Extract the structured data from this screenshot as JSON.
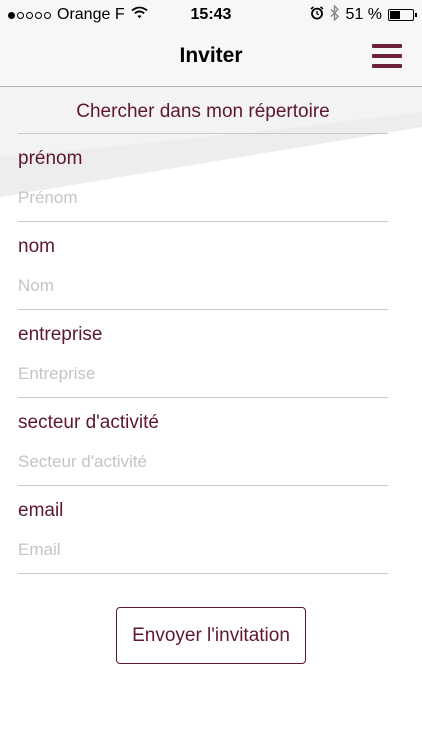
{
  "status_bar": {
    "carrier": "Orange F",
    "time": "15:43",
    "battery": "51 %",
    "battery_level": 0.51,
    "signal_bars_filled": 1,
    "signal_bars_total": 5,
    "icons": [
      "signal-dots-icon",
      "wifi-icon",
      "alarm-icon",
      "bluetooth-icon",
      "battery-icon"
    ]
  },
  "nav": {
    "title": "Inviter",
    "menu_icon": "hamburger-menu-icon"
  },
  "search_directory": "Chercher dans mon répertoire",
  "fields": [
    {
      "label": "prénom",
      "placeholder": "Prénom"
    },
    {
      "label": "nom",
      "placeholder": "Nom"
    },
    {
      "label": "entreprise",
      "placeholder": "Entreprise"
    },
    {
      "label": "secteur d'activité",
      "placeholder": "Secteur d'activité"
    },
    {
      "label": "email",
      "placeholder": "Email"
    }
  ],
  "submit_label": "Envoyer l'invitation",
  "colors": {
    "accent": "#5d1731",
    "menu": "#6e1f3a",
    "bar_background": "#f7f7f7",
    "placeholder": "#c4c4c4"
  }
}
